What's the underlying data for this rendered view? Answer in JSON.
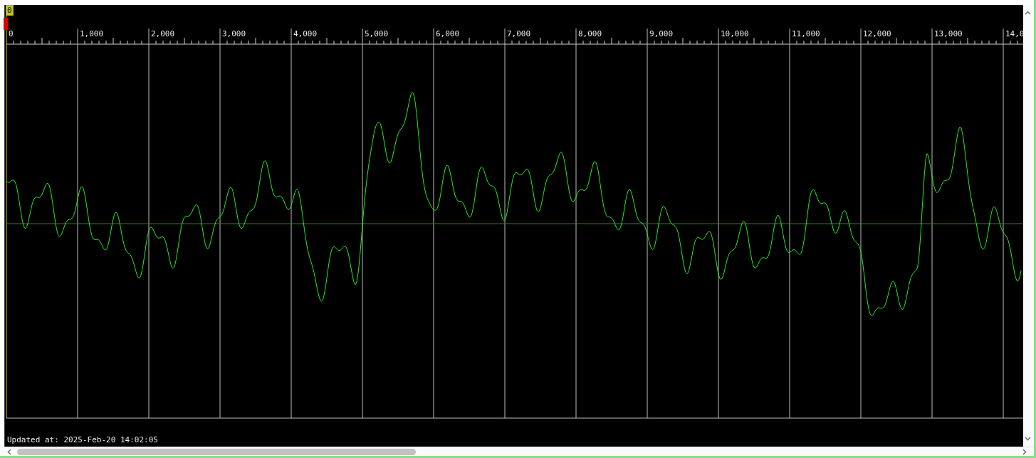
{
  "marker": {
    "label": "0"
  },
  "ruler": {
    "labels": [
      "0",
      "1,000",
      "2,000",
      "3,000",
      "4,000",
      "5,000",
      "6,000",
      "7,000",
      "8,000",
      "9,000",
      "10,000",
      "11,000",
      "12,000",
      "13,000",
      "14,0"
    ]
  },
  "status": {
    "text": "Updated at: 2025-Feb-20 14:02:05"
  }
}
